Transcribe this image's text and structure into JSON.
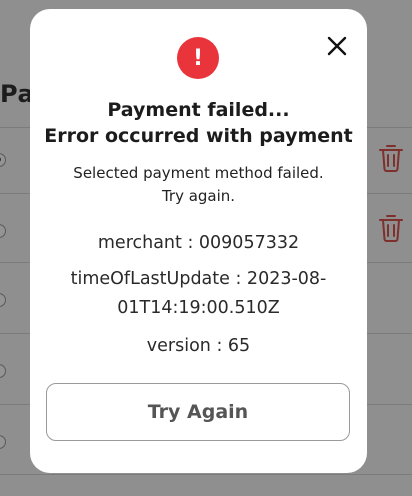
{
  "background": {
    "heading": "Pa"
  },
  "modal": {
    "alert_symbol": "!",
    "close_symbol": "×",
    "title_line1": "Payment failed...",
    "title_line2": "Error occurred with payment",
    "message_line1": "Selected payment method failed.",
    "message_line2": "Try again.",
    "merchant": "merchant : 009057332",
    "last_update_line1": "timeOfLastUpdate : 2023-08-",
    "last_update_line2": "01T14:19:00.510Z",
    "version": "version : 65",
    "try_again_label": "Try Again"
  },
  "colors": {
    "alert": "#e8343a",
    "trash": "#d9534f"
  },
  "icons": {
    "alert": "exclamation-circle-icon",
    "close": "close-icon",
    "delete": "trash-icon"
  }
}
